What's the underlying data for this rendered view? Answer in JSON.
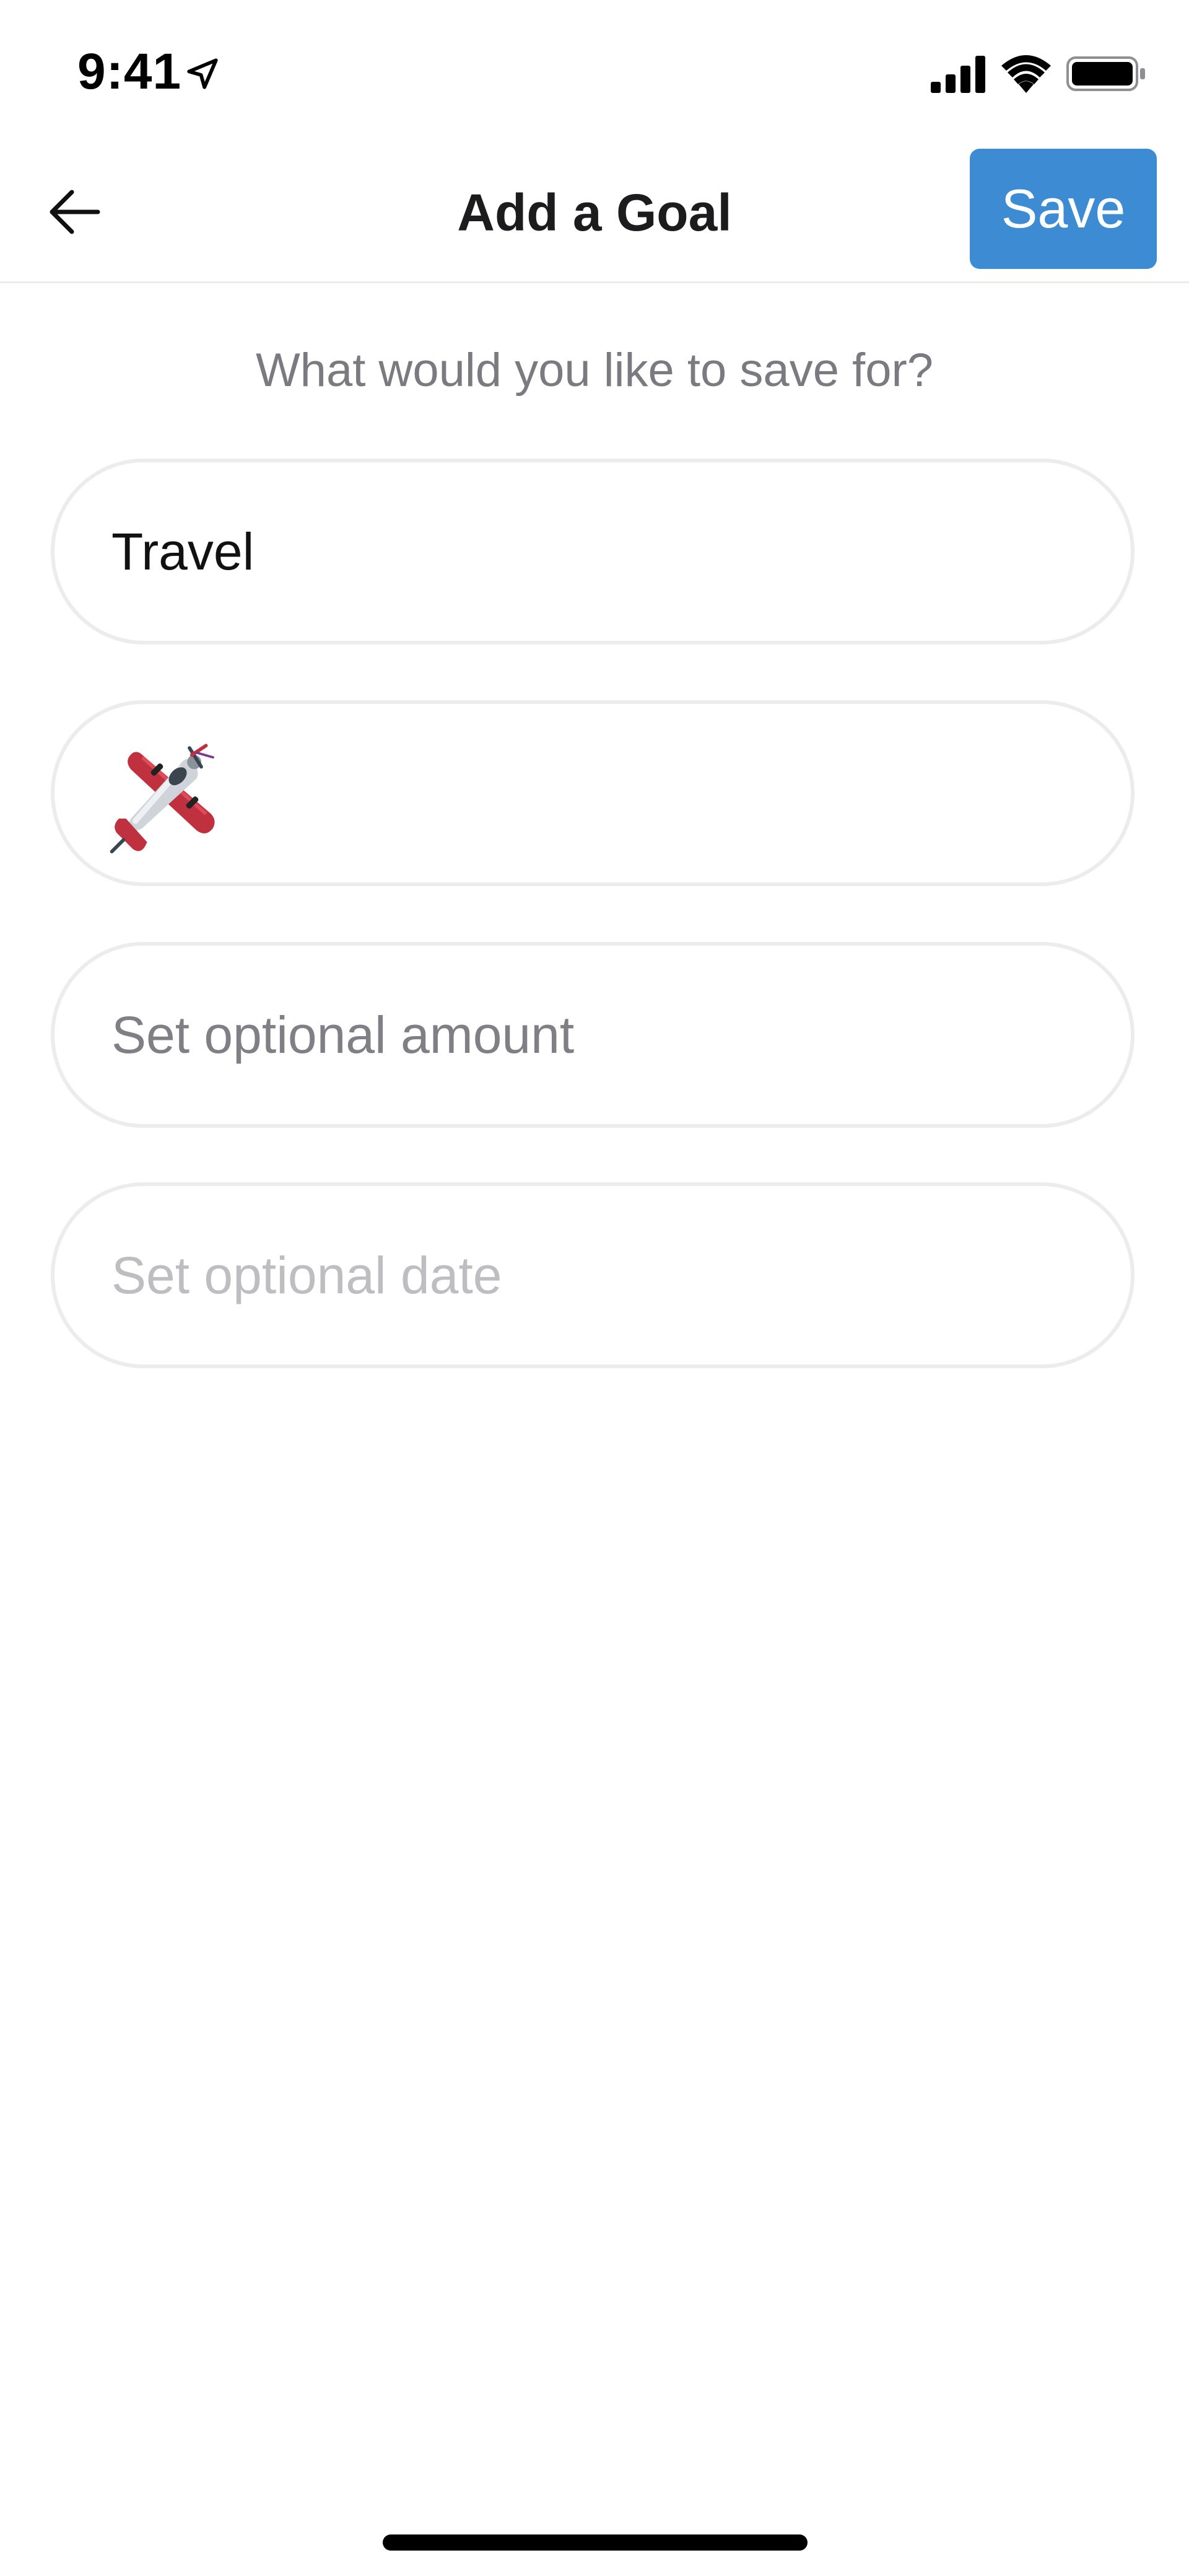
{
  "status_bar": {
    "time": "9:41",
    "icons": [
      "location-arrow-icon",
      "cellular-signal-icon",
      "wifi-icon",
      "battery-icon"
    ]
  },
  "nav": {
    "back_icon": "arrow-left-icon",
    "title": "Add a Goal",
    "save_label": "Save"
  },
  "form": {
    "prompt": "What would you like to save for?",
    "goal_name": {
      "value": "Travel"
    },
    "goal_emoji": {
      "icon": "small-airplane-icon"
    },
    "amount": {
      "placeholder": "Set optional amount"
    },
    "date": {
      "placeholder": "Set optional date"
    }
  },
  "colors": {
    "accent": "#3d8bd2",
    "field_border": "#ececee",
    "prompt_text": "#7a7a80",
    "placeholder_amount": "#7f7f85",
    "placeholder_date": "#bdbdc2"
  }
}
